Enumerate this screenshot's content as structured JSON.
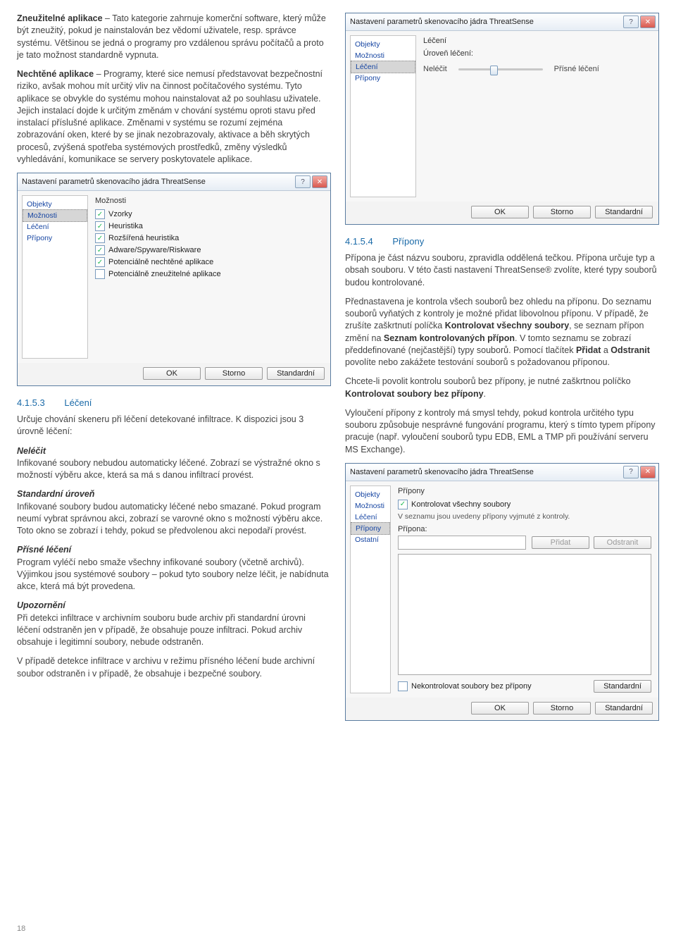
{
  "col1": {
    "para1": {
      "lead": "Zneužitelné aplikace",
      "text": " – Tato kategorie zahrnuje komerční software, který může být zneužitý, pokud je nainstalován bez vědomí uživatele, resp. správce systému. Většinou se jedná o programy pro vzdálenou správu počítačů a proto je tato možnost standardně vypnuta."
    },
    "para2": {
      "lead": "Nechtěné aplikace",
      "text": " – Programy, které sice nemusí představovat bezpečnostní riziko, avšak mohou mít určitý vliv na činnost počítačového systému. Tyto aplikace se obvykle do systému mohou nainstalovat až po souhlasu uživatele. Jejich instalací dojde k určitým změnám v chování systému oproti stavu před instalací příslušné aplikace. Změnami v systému se rozumí zejména zobrazování oken, které by se jinak nezobrazovaly, aktivace a běh skrytých procesů, zvýšená spotřeba systémových prostředků, změny výsledků vyhledávání, komunikace se servery poskytovatele aplikace."
    },
    "dialog_moznosti": {
      "title": "Nastavení parametrů skenovacího jádra ThreatSense",
      "nav": [
        "Objekty",
        "Možnosti",
        "Léčení",
        "Přípony"
      ],
      "nav_sel": "Možnosti",
      "group": "Možnosti",
      "checks": [
        {
          "checked": true,
          "label": "Vzorky"
        },
        {
          "checked": true,
          "label": "Heuristika"
        },
        {
          "checked": true,
          "label": "Rozšířená heuristika"
        },
        {
          "checked": true,
          "label": "Adware/Spyware/Riskware"
        },
        {
          "checked": true,
          "label": "Potenciálně nechtěné aplikace"
        },
        {
          "checked": false,
          "label": "Potenciálně zneužitelné aplikace"
        }
      ],
      "buttons": {
        "ok": "OK",
        "cancel": "Storno",
        "std": "Standardní"
      }
    },
    "sec_4153": {
      "num": "4.1.5.3",
      "title": "Léčení"
    },
    "para3": "Určuje chování skeneru při léčení detekované infiltrace. K dispozici jsou 3 úrovně léčení:",
    "block_nelecit": {
      "head": "Neléčit",
      "text": "Infikované soubory nebudou automaticky léčené. Zobrazí se výstražné okno s možností výběru akce, která sa má s danou infiltrací provést."
    },
    "block_std": {
      "head": "Standardní úroveň",
      "text": "Infikované soubory budou automaticky léčené nebo smazané. Pokud program neumí vybrat správnou akci, zobrazí se varovné okno s možností výběru akce. Toto okno se zobrazí i tehdy, pokud se předvolenou akci nepodaří provést."
    },
    "block_prisne": {
      "head": "Přísné léčení",
      "text": "Program vyléčí nebo smaže všechny infikované soubory (včetně archivů). Výjimkou jsou systémové soubory – pokud tyto soubory nelze léčit, je nabídnuta akce, která má být provedena."
    },
    "block_upoz": {
      "head": "Upozornění",
      "text": "Při detekci infiltrace v archivním souboru bude archiv při standardní úrovni léčení odstraněn jen v případě, že obsahuje pouze infiltraci. Pokud archiv obsahuje i legitimní soubory, nebude odstraněn."
    },
    "para_last": "V případě detekce infiltrace v archivu v režimu přísného léčení bude archivní soubor odstraněn i v případě, že obsahuje i bezpečné soubory."
  },
  "col2": {
    "dialog_leceni": {
      "title": "Nastavení parametrů skenovacího jádra ThreatSense",
      "nav": [
        "Objekty",
        "Možnosti",
        "Léčení",
        "Přípony"
      ],
      "nav_sel": "Léčení",
      "group": "Léčení",
      "label_uroven": "Úroveň léčení:",
      "slider_left": "Neléčit",
      "slider_right": "Přísné léčení",
      "buttons": {
        "ok": "OK",
        "cancel": "Storno",
        "std": "Standardní"
      }
    },
    "sec_4154": {
      "num": "4.1.5.4",
      "title": "Přípony"
    },
    "para1": "Přípona je část názvu souboru, zpravidla oddělená tečkou. Přípona určuje typ a obsah souboru. V této časti nastavení ThreatSense® zvolíte, které typy souborů budou kontrolované.",
    "para2_a": "Přednastavena je kontrola všech souborů bez ohledu na příponu. Do seznamu souborů vyňatých z kontroly je možné přidat libovolnou příponu. V případě, že zrušíte zaškrtnutí políčka ",
    "para2_b1": "Kontrolovat všechny soubory",
    "para2_c": ", se seznam přípon změní na ",
    "para2_b2": "Seznam kontrolovaných přípon",
    "para2_d": ". V tomto seznamu se zobrazí předdefinované (nejčastější) typy souborů. Pomocí tlačítek ",
    "para2_b3": "Přidat",
    "para2_e": " a ",
    "para2_b4": "Odstranit",
    "para2_f": " povolíte nebo zakážete testování souborů s požadovanou příponou.",
    "para3_a": "Chcete-li povolit kontrolu souborů bez přípony, je nutné zaškrtnou políčko ",
    "para3_b": "Kontrolovat soubory bez přípony",
    "para3_c": ".",
    "para4": "Vyloučení přípony z kontroly má smysl tehdy, pokud kontrola určitého typu souboru způsobuje nesprávné fungování programu, který s tímto typem přípony pracuje (např. vyloučení souborů typu EDB, EML a TMP při používání serveru MS Exchange).",
    "dialog_pripony": {
      "title": "Nastavení parametrů skenovacího jádra ThreatSense",
      "nav": [
        "Objekty",
        "Možnosti",
        "Léčení",
        "Přípony",
        "Ostatní"
      ],
      "nav_sel": "Přípony",
      "group": "Přípony",
      "chk_all": "Kontrolovat všechny soubory",
      "note": "V seznamu jsou uvedeny přípony vyjmuté z kontroly.",
      "lbl_pripona": "Přípona:",
      "btn_add": "Přidat",
      "btn_del": "Odstranit",
      "chk_noext": "Nekontrolovat soubory bez přípony",
      "buttons": {
        "ok": "OK",
        "cancel": "Storno",
        "std": "Standardní"
      }
    }
  },
  "page_num": "18"
}
